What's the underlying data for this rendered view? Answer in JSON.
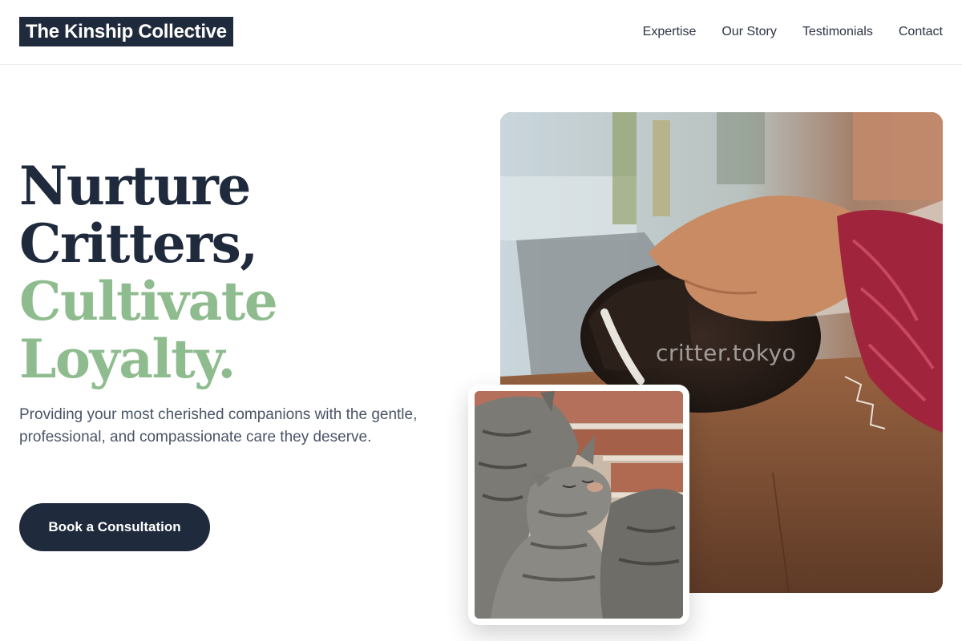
{
  "header": {
    "logo": "The Kinship Collective",
    "nav": [
      "Expertise",
      "Our Story",
      "Testimonials",
      "Contact"
    ]
  },
  "hero": {
    "title_lines": [
      {
        "text": "Nurture",
        "tone": "dark"
      },
      {
        "text": "Critters,",
        "tone": "dark"
      },
      {
        "text": "Cultivate",
        "tone": "green"
      },
      {
        "text": "Loyalty.",
        "tone": "green"
      }
    ],
    "subtitle": "Providing your most cherished companions with the gentle, professional, and compassionate care they deserve.",
    "cta_label": "Book a Consultation"
  },
  "images": {
    "main_watermark": "critter.tokyo"
  },
  "colors": {
    "navy": "#1f2a3d",
    "sage": "#8fbc8f",
    "body_text": "#4a5466"
  }
}
